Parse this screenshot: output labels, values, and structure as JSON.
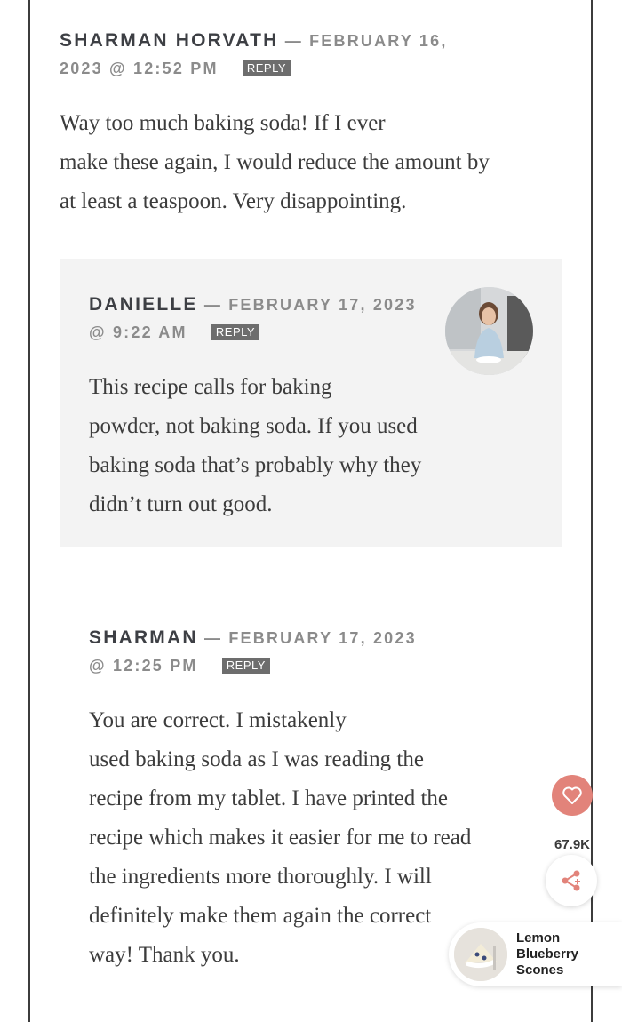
{
  "comments": [
    {
      "author": "SHARMAN HORVATH",
      "date_line1": "— FEBRUARY 16,",
      "date_line2": "2023 @ 12:52 PM",
      "reply_label": "REPLY",
      "body_lines": [
        "Way too much baking soda! If I ever",
        "make these again, I would reduce the amount by",
        "at least a teaspoon. Very disappointing."
      ]
    },
    {
      "author": "DANIELLE",
      "date_line1": "— FEBRUARY 17, 2023",
      "date_line2": "@ 9:22 AM",
      "reply_label": "REPLY",
      "body_lines": [
        "This recipe calls for baking",
        "powder, not baking soda. If you used",
        "baking soda that’s probably why they",
        "didn’t turn out good."
      ]
    },
    {
      "author": "SHARMAN",
      "date_line1": "— FEBRUARY 17, 2023",
      "date_line2": "@ 12:25 PM",
      "reply_label": "REPLY",
      "body_lines": [
        "You are correct. I mistakenly",
        "used baking soda as I was reading the",
        "recipe from my tablet. I have printed the",
        "recipe which makes it easier for me to read",
        "the ingredients more thoroughly. I will",
        "definitely make them again the correct",
        "way! Thank you."
      ]
    }
  ],
  "floating": {
    "heart_icon": "heart-icon",
    "share_count": "67.9K",
    "share_icon": "share-icon",
    "heart_color": "#e2837a"
  },
  "recipe_card": {
    "title_lines": [
      "Lemon",
      "Blueberry",
      "Scones"
    ]
  }
}
